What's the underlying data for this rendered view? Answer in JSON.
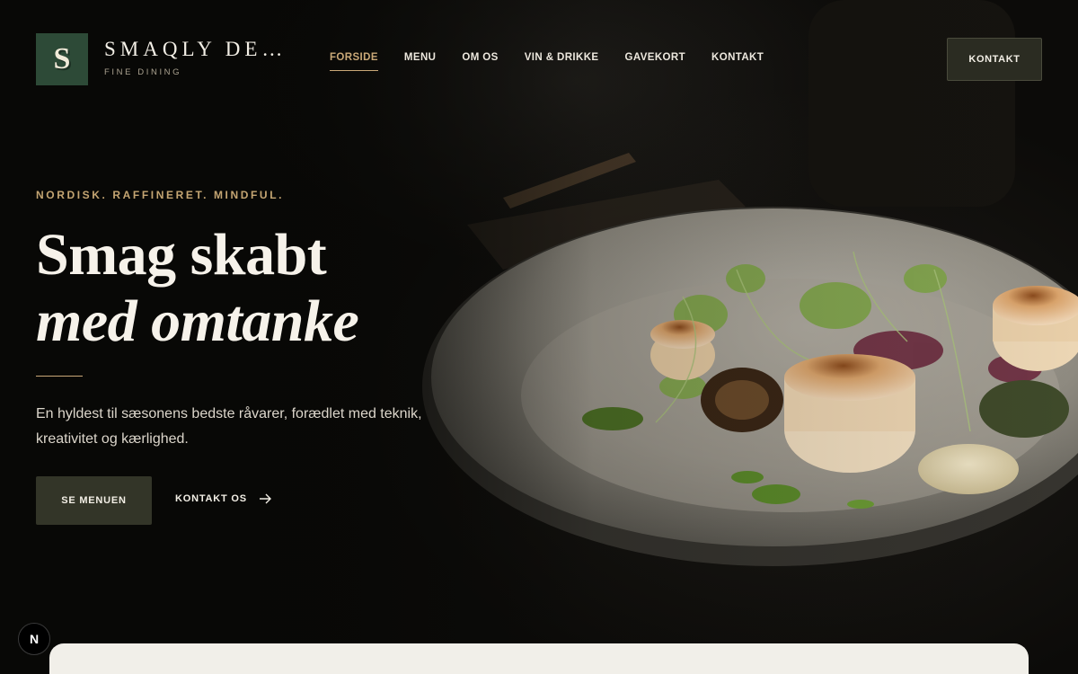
{
  "header": {
    "logo_letter": "S",
    "brand_name": "SMAQLY DE…",
    "brand_tagline": "FINE DINING",
    "nav": [
      {
        "label": "FORSIDE",
        "active": true
      },
      {
        "label": "MENU",
        "active": false
      },
      {
        "label": "OM OS",
        "active": false
      },
      {
        "label": "VIN & DRIKKE",
        "active": false
      },
      {
        "label": "GAVEKORT",
        "active": false
      },
      {
        "label": "KONTAKT",
        "active": false
      }
    ],
    "cta_label": "KONTAKT"
  },
  "hero": {
    "eyebrow": "NORDISK. RAFFINERET. MINDFUL.",
    "headline_line1": "Smag skabt",
    "headline_line2": "med omtanke",
    "lead": "En hyldest til sæsonens bedste råvarer, forædlet med teknik, kreativitet og kærlighed.",
    "primary_button": "SE MENUEN",
    "secondary_link": "KONTAKT OS",
    "secondary_icon": "arrow-right-icon",
    "background_image": "plated-scallops-dish-photo"
  },
  "footer_badge": "N",
  "colors": {
    "accent_gold": "#c9a877",
    "logo_green": "#2d4a37",
    "button_olive": "#333528",
    "background": "#0b0a08",
    "card": "#f1efe9"
  }
}
